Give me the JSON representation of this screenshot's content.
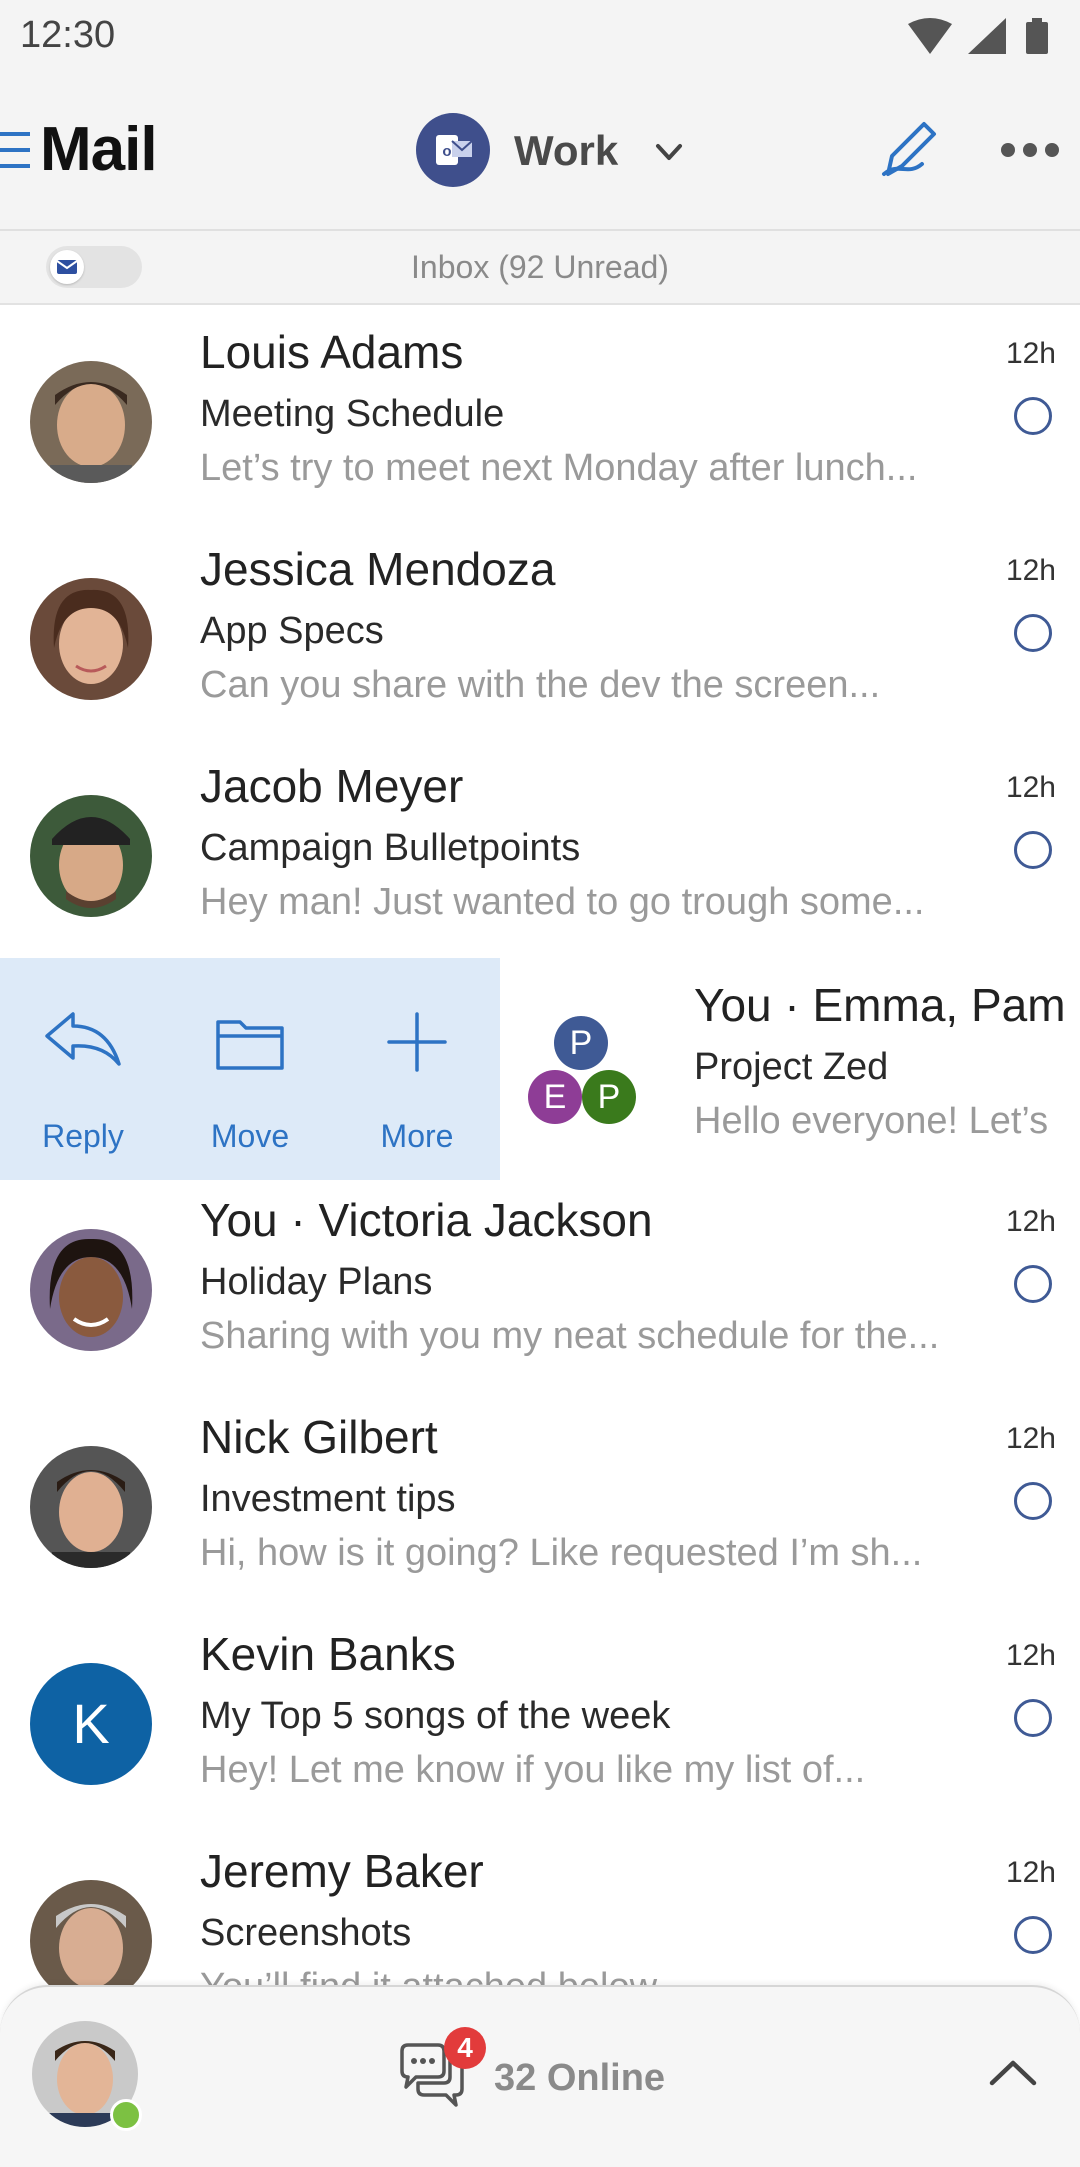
{
  "status_bar": {
    "time": "12:30"
  },
  "header": {
    "title": "Mail",
    "account": "Work"
  },
  "inbox": {
    "label": "Inbox (92 Unread)"
  },
  "emails": [
    {
      "sender": "Louis Adams",
      "subject": "Meeting Schedule",
      "preview": "Let’s try to meet next Monday after lunch...",
      "time": "12h"
    },
    {
      "sender": "Jessica Mendoza",
      "subject": "App Specs",
      "preview": "Can you share with the dev the screen...",
      "time": "12h"
    },
    {
      "sender": "Jacob Meyer",
      "subject": "Campaign Bulletpoints",
      "preview": "Hey man! Just wanted to go trough some...",
      "time": "12h"
    },
    {
      "sender": "You · Emma, Pam",
      "subject": "Project Zed",
      "preview": "Hello everyone! Let’s",
      "time": ""
    },
    {
      "sender": "You · Victoria Jackson",
      "subject": "Holiday Plans",
      "preview": "Sharing with you my neat schedule for the...",
      "time": "12h"
    },
    {
      "sender": "Nick Gilbert",
      "subject": "Investment tips",
      "preview": "Hi, how is it going? Like requested I’m sh...",
      "time": "12h"
    },
    {
      "sender": "Kevin Banks",
      "subject": "My Top 5 songs of the week",
      "preview": "Hey! Let me know if you like my list of...",
      "time": "12h",
      "avatar_letter": "K"
    },
    {
      "sender": "Jeremy Baker",
      "subject": "Screenshots",
      "preview": "You’ll find it attached below",
      "time": "12h"
    }
  ],
  "swipe_actions": [
    {
      "label": "Reply",
      "icon": "reply-icon"
    },
    {
      "label": "Move",
      "icon": "folder-icon"
    },
    {
      "label": "More",
      "icon": "plus-icon"
    }
  ],
  "group_avatar": {
    "members": [
      {
        "letter": "P",
        "color": "#3f5a95"
      },
      {
        "letter": "E",
        "color": "#8e3d96"
      },
      {
        "letter": "P",
        "color": "#3a7a1c"
      }
    ]
  },
  "bottom_bar": {
    "badge_count": "4",
    "online_text": "32 Online"
  },
  "colors": {
    "accent": "#2d73c4",
    "unread": "#3f5a95",
    "swipe_bg": "#ddeaf8",
    "badge": "#e23b3b",
    "online": "#7cc142"
  }
}
